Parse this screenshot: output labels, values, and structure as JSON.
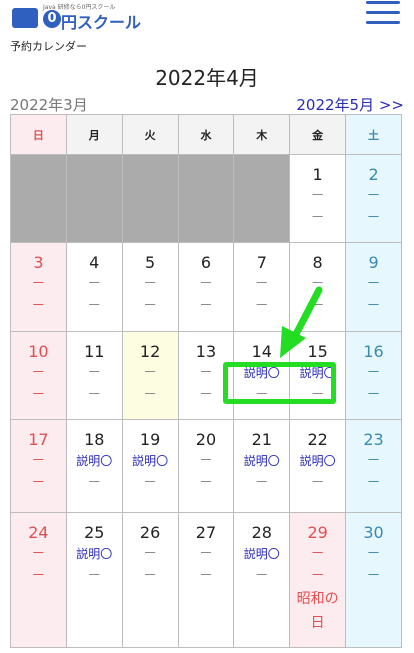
{
  "header": {
    "logo_small": "Java 研修なら0円スクール",
    "logo_zero": "0",
    "logo_text": "円スクール"
  },
  "page_label": "予約カレンダー",
  "month_title": "2022年4月",
  "prev_month": "2022年3月",
  "next_month": "2022年5月 >>",
  "weekdays": [
    "日",
    "月",
    "火",
    "水",
    "木",
    "金",
    "土"
  ],
  "dash": "－",
  "event_label": "説明〇",
  "weeks": [
    [
      {
        "day": "",
        "l2": "",
        "l3": ""
      },
      {
        "day": "",
        "l2": "",
        "l3": ""
      },
      {
        "day": "",
        "l2": "",
        "l3": ""
      },
      {
        "day": "",
        "l2": "",
        "l3": ""
      },
      {
        "day": "",
        "l2": "",
        "l3": ""
      },
      {
        "day": "1",
        "l2": "－",
        "l3": "－"
      },
      {
        "day": "2",
        "l2": "－",
        "l3": "－"
      }
    ],
    [
      {
        "day": "3",
        "l2": "－",
        "l3": "－"
      },
      {
        "day": "4",
        "l2": "－",
        "l3": "－"
      },
      {
        "day": "5",
        "l2": "－",
        "l3": "－"
      },
      {
        "day": "6",
        "l2": "－",
        "l3": "－"
      },
      {
        "day": "7",
        "l2": "－",
        "l3": "－"
      },
      {
        "day": "8",
        "l2": "－",
        "l3": "－"
      },
      {
        "day": "9",
        "l2": "－",
        "l3": "－"
      }
    ],
    [
      {
        "day": "10",
        "l2": "－",
        "l3": "－"
      },
      {
        "day": "11",
        "l2": "－",
        "l3": "－"
      },
      {
        "day": "12",
        "l2": "－",
        "l3": "－"
      },
      {
        "day": "13",
        "l2": "－",
        "l3": "－"
      },
      {
        "day": "14",
        "l2": "説明〇",
        "l3": "－"
      },
      {
        "day": "15",
        "l2": "説明〇",
        "l3": "－"
      },
      {
        "day": "16",
        "l2": "－",
        "l3": "－"
      }
    ],
    [
      {
        "day": "17",
        "l2": "－",
        "l3": "－"
      },
      {
        "day": "18",
        "l2": "説明〇",
        "l3": "－"
      },
      {
        "day": "19",
        "l2": "説明〇",
        "l3": "－"
      },
      {
        "day": "20",
        "l2": "－",
        "l3": "－"
      },
      {
        "day": "21",
        "l2": "説明〇",
        "l3": "－"
      },
      {
        "day": "22",
        "l2": "説明〇",
        "l3": "－"
      },
      {
        "day": "23",
        "l2": "－",
        "l3": "－"
      }
    ],
    [
      {
        "day": "24",
        "l2": "－",
        "l3": "－"
      },
      {
        "day": "25",
        "l2": "説明〇",
        "l3": "－"
      },
      {
        "day": "26",
        "l2": "－",
        "l3": "－"
      },
      {
        "day": "27",
        "l2": "－",
        "l3": "－"
      },
      {
        "day": "28",
        "l2": "説明〇",
        "l3": "－"
      },
      {
        "day": "29",
        "l2": "－",
        "l3": "－",
        "holiday_name": "昭和の日"
      },
      {
        "day": "30",
        "l2": "－",
        "l3": "－"
      }
    ]
  ],
  "colors": {
    "brand": "#2f5fbf",
    "sunday": "#e05050",
    "saturday": "#3a8ab0",
    "link": "#2a2ab8",
    "highlight": "#22dd22"
  }
}
